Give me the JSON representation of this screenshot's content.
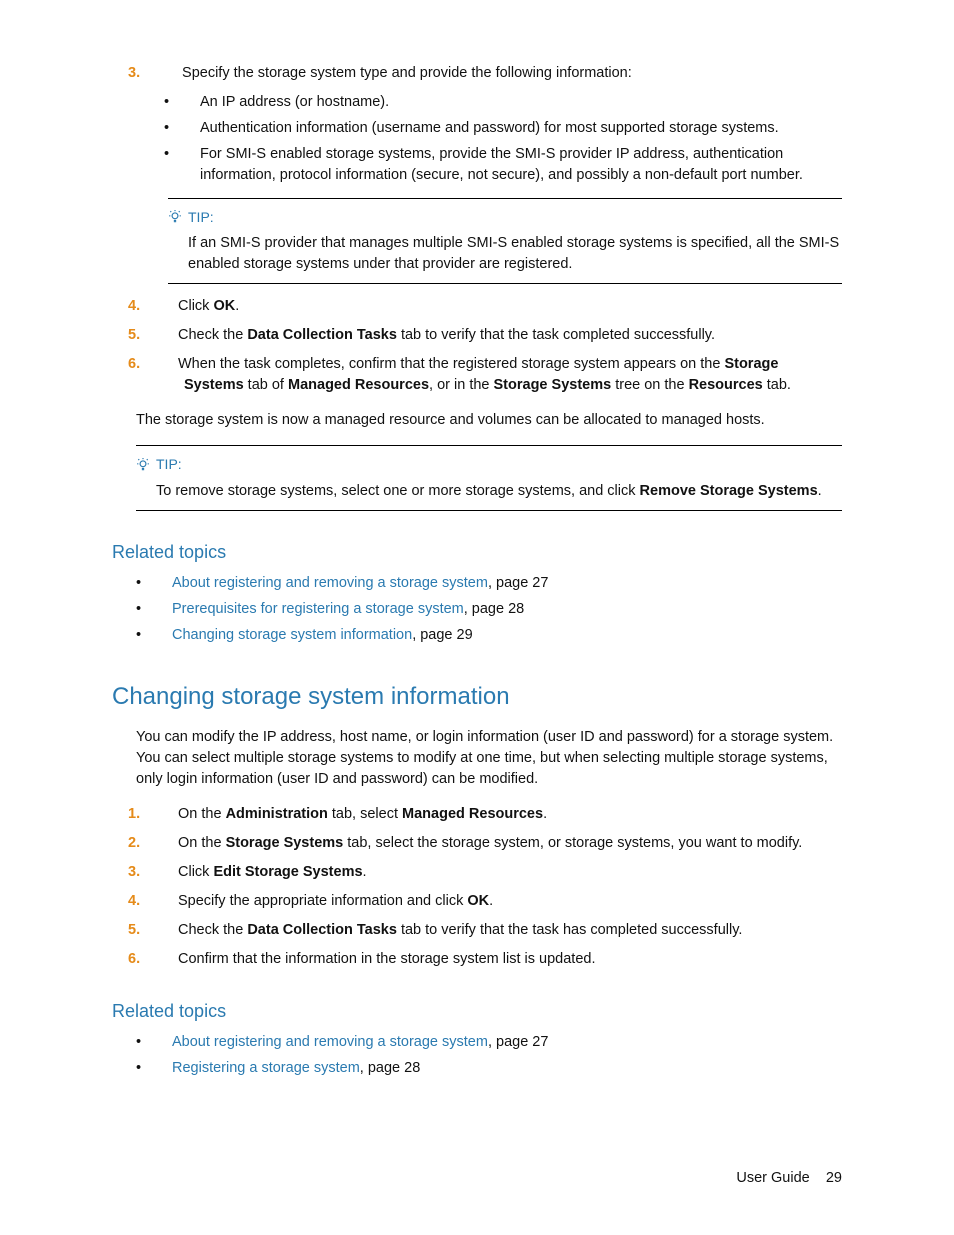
{
  "step3": {
    "num": "3.",
    "text": "Specify the storage system type and provide the following information:",
    "bullets": [
      "An IP address (or hostname).",
      "Authentication information (username and password) for most supported storage systems.",
      "For SMI-S enabled storage systems, provide the SMI-S provider IP address, authentication information, protocol information (secure, not secure), and possibly a non-default port number."
    ]
  },
  "tip1": {
    "label": "TIP:",
    "body": "If an SMI-S provider that manages multiple SMI-S enabled storage systems is specified, all the SMI-S enabled storage systems under that provider are registered."
  },
  "step4": {
    "num": "4.",
    "pre": "Click ",
    "bold1": "OK",
    "post": "."
  },
  "step5": {
    "num": "5.",
    "pre": "Check the ",
    "bold1": "Data Collection Tasks",
    "post": " tab to verify that the task completed successfully."
  },
  "step6": {
    "num": "6.",
    "pre": "When the task completes, confirm that the registered storage system appears on the ",
    "b1": "Storage Systems",
    "mid1": " tab of ",
    "b2": "Managed Resources",
    "mid2": ", or in the ",
    "b3": "Storage Systems",
    "mid3": " tree on the ",
    "b4": "Resources",
    "post": " tab."
  },
  "para1": "The storage system is now a managed resource and volumes can be allocated to managed hosts.",
  "tip2": {
    "label": "TIP:",
    "pre": "To remove storage systems, select one or more storage systems, and click ",
    "bold1": "Remove Storage Systems",
    "post": "."
  },
  "related1": {
    "heading": "Related topics",
    "items": [
      {
        "link": "About registering and removing a storage system",
        "suffix": ", page 27"
      },
      {
        "link": "Prerequisites for registering a storage system",
        "suffix": ", page 28"
      },
      {
        "link": "Changing storage system information",
        "suffix": ", page 29"
      }
    ]
  },
  "section2": {
    "heading": "Changing storage system information",
    "intro": "You can modify the IP address, host name, or login information (user ID and password) for a storage system. You can select multiple storage systems to modify at one time, but when selecting multiple storage systems, only login information (user ID and password) can be modified.",
    "s1": {
      "num": "1.",
      "pre": "On the ",
      "b1": "Administration",
      "mid": " tab, select ",
      "b2": "Managed Resources",
      "post": "."
    },
    "s2": {
      "num": "2.",
      "pre": "On the ",
      "b1": "Storage Systems",
      "post": " tab, select the storage system, or storage systems, you want to modify."
    },
    "s3": {
      "num": "3.",
      "pre": "Click ",
      "b1": "Edit Storage Systems",
      "post": "."
    },
    "s4": {
      "num": "4.",
      "pre": "Specify the appropriate information and click ",
      "b1": "OK",
      "post": "."
    },
    "s5": {
      "num": "5.",
      "pre": "Check the ",
      "b1": "Data Collection Tasks",
      "post": " tab to verify that the task has completed successfully."
    },
    "s6": {
      "num": "6.",
      "text": "Confirm that the information in the storage system list is updated."
    }
  },
  "related2": {
    "heading": "Related topics",
    "items": [
      {
        "link": "About registering and removing a storage system",
        "suffix": ", page 27"
      },
      {
        "link": "Registering a storage system",
        "suffix": ", page 28"
      }
    ]
  },
  "footer": {
    "label": "User Guide",
    "page": "29"
  }
}
